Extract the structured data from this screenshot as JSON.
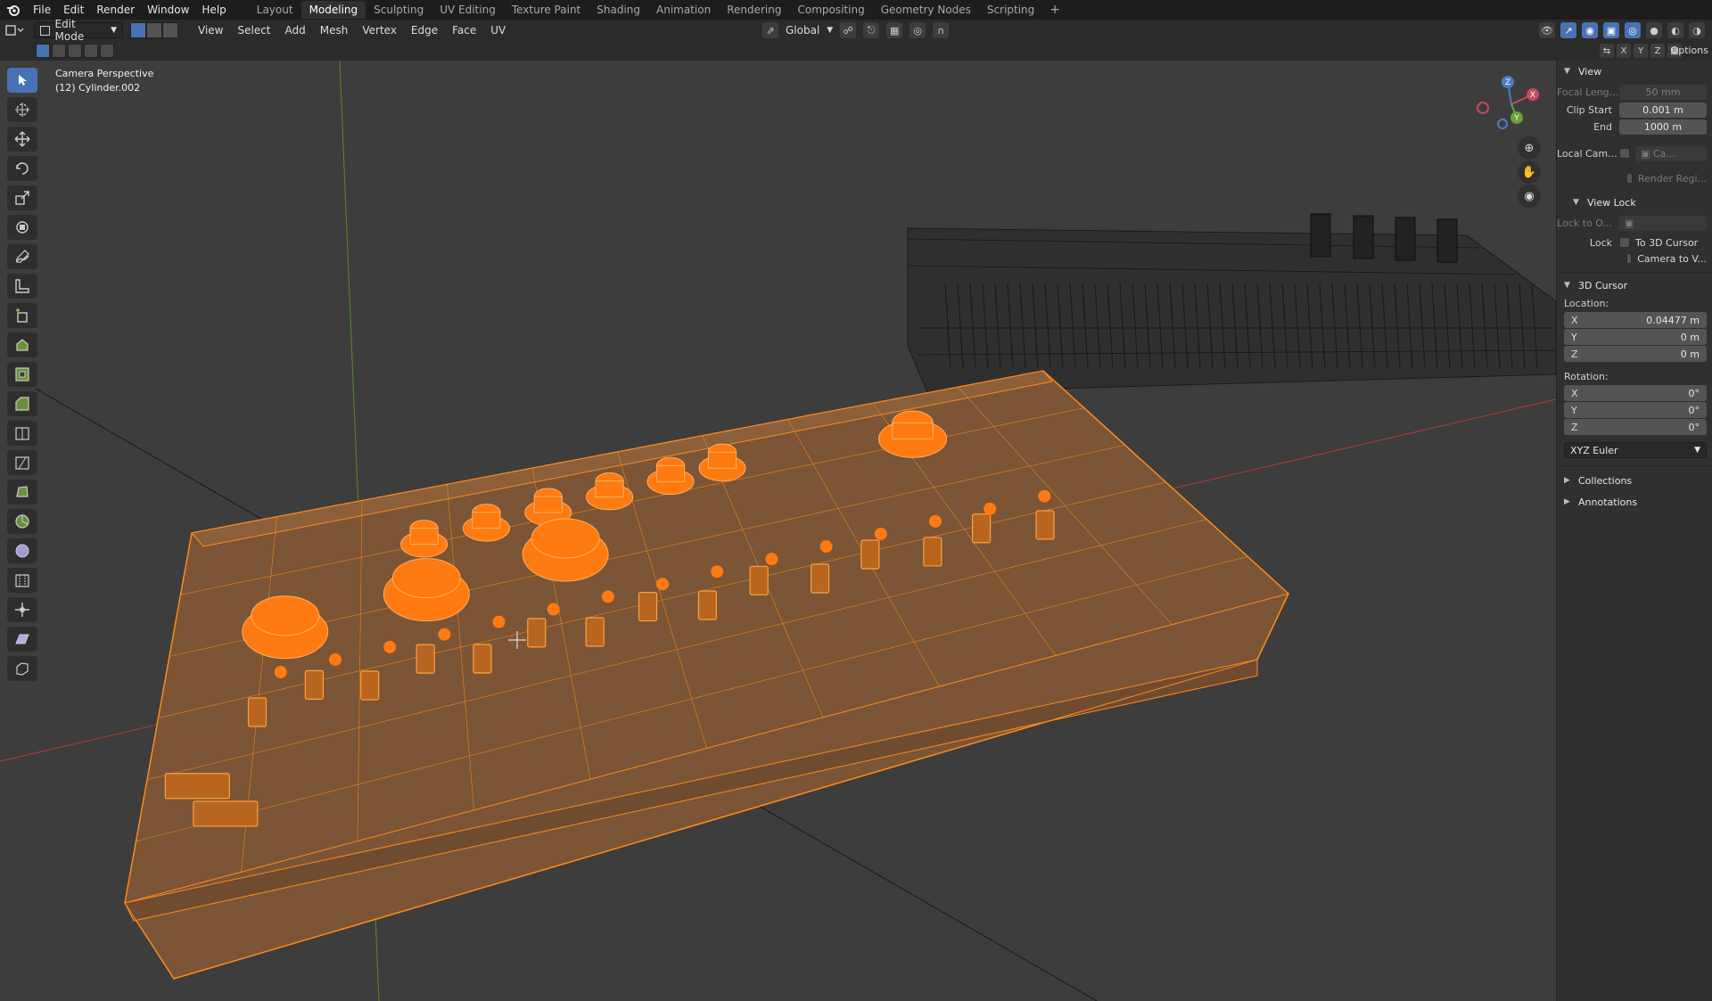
{
  "menubar": {
    "items": [
      "File",
      "Edit",
      "Render",
      "Window",
      "Help"
    ],
    "workspaces": [
      "Layout",
      "Modeling",
      "Sculpting",
      "UV Editing",
      "Texture Paint",
      "Shading",
      "Animation",
      "Rendering",
      "Compositing",
      "Geometry Nodes",
      "Scripting"
    ],
    "active_workspace": "Modeling",
    "add_tab": "+"
  },
  "header": {
    "mode": "Edit Mode",
    "menus": [
      "View",
      "Select",
      "Add",
      "Mesh",
      "Vertex",
      "Edge",
      "Face",
      "UV"
    ],
    "orientation": "Global",
    "options_label": "Options",
    "axis_labels": [
      "X",
      "Y",
      "Z"
    ]
  },
  "viewport": {
    "perspective_label": "Camera Perspective",
    "object_label": "(12) Cylinder.002",
    "gizmo_axes": [
      "Z",
      "X",
      "Y"
    ]
  },
  "sidebar": {
    "view_panel": {
      "title": "View",
      "focal_label": "Focal Leng...",
      "focal_value": "50 mm",
      "clip_start_label": "Clip Start",
      "clip_start_value": "0.001 m",
      "clip_end_label": "End",
      "clip_end_value": "1000 m",
      "local_camera_label": "Local Cam...",
      "local_camera_value": "Ca...",
      "render_region_label": "Render Regi..."
    },
    "view_lock_panel": {
      "title": "View Lock",
      "lock_to_object_label": "Lock to O...",
      "lock_label": "Lock",
      "to_3d_cursor_label": "To 3D Cursor",
      "camera_to_view_label": "Camera to V..."
    },
    "cursor_panel": {
      "title": "3D Cursor",
      "location_label": "Location:",
      "location": [
        {
          "axis": "X",
          "value": "0.04477 m"
        },
        {
          "axis": "Y",
          "value": "0 m"
        },
        {
          "axis": "Z",
          "value": "0 m"
        }
      ],
      "rotation_label": "Rotation:",
      "rotation": [
        {
          "axis": "X",
          "value": "0°"
        },
        {
          "axis": "Y",
          "value": "0°"
        },
        {
          "axis": "Z",
          "value": "0°"
        }
      ],
      "rotation_mode": "XYZ Euler"
    },
    "collections_title": "Collections",
    "annotations_title": "Annotations"
  },
  "colors": {
    "selection_orange": "#ff8a1c",
    "active_blue": "#4772b3",
    "axis_x_red": "#c23c3c",
    "axis_y_green": "#6a9a2a",
    "viewport_bg": "#3d3d3d"
  }
}
